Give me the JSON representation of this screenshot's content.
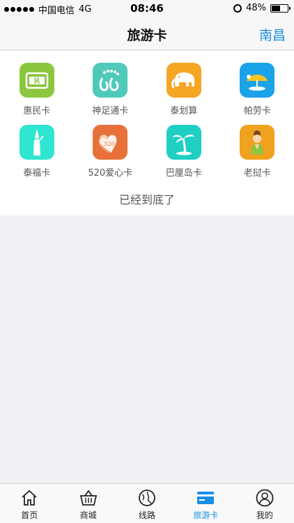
{
  "status_bar": {
    "carrier": "中国电信",
    "network": "4G",
    "time": "08:46",
    "battery": "48%",
    "battery_level": 0.48
  },
  "header": {
    "title": "旅游卡",
    "city": "南昌"
  },
  "cards": [
    {
      "label": "惠民卡",
      "icon": "card-icon",
      "color": "#8cc63f"
    },
    {
      "label": "神足通卡",
      "icon": "footprint-icon",
      "color": "#4fc9b9"
    },
    {
      "label": "泰划算",
      "icon": "elephant-icon",
      "color": "#f5a623"
    },
    {
      "label": "帕劳卡",
      "icon": "island-umbrella-icon",
      "color": "#1aa3e8"
    },
    {
      "label": "泰福卡",
      "icon": "statue-icon",
      "color": "#2ee6d0"
    },
    {
      "label": "520爱心卡",
      "icon": "hearts-icon",
      "color": "#e8713a"
    },
    {
      "label": "巴厘岛卡",
      "icon": "palm-tree-icon",
      "color": "#1fcfc4"
    },
    {
      "label": "老挝卡",
      "icon": "woman-icon",
      "color": "#f0a21e"
    }
  ],
  "end_text": "已经到底了",
  "tabs": [
    {
      "label": "首页",
      "icon": "home-icon",
      "active": false
    },
    {
      "label": "商城",
      "icon": "basket-icon",
      "active": false
    },
    {
      "label": "线路",
      "icon": "globe-icon",
      "active": false
    },
    {
      "label": "旅游卡",
      "icon": "card-icon",
      "active": true
    },
    {
      "label": "我的",
      "icon": "profile-icon",
      "active": false
    }
  ],
  "colors": {
    "accent": "#1a8fe3"
  }
}
